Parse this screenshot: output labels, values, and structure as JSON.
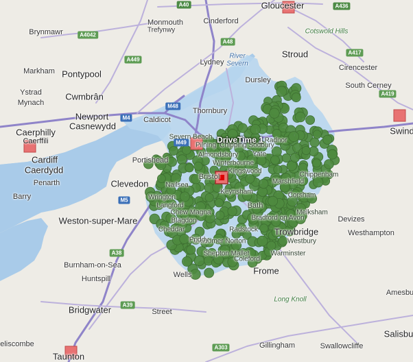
{
  "map": {
    "drivetime_label": "DriveTime 1",
    "colors": {
      "water": "#a9cbe9",
      "land": "#eeece6",
      "drivetime_area": "#b7d6ee",
      "point_fill": "#4e8a3f",
      "point_stroke": "#3d6e31",
      "site_marker": "#e87272",
      "site_marker_center": "#dd0000",
      "motorway": "#8f84c9",
      "road": "#bcb1dc"
    },
    "places": [
      {
        "name": "Gloucester",
        "kind": "town"
      },
      {
        "name": "Monmouth",
        "kind": "place"
      },
      {
        "name": "Trefynwy",
        "kind": "place"
      },
      {
        "name": "Cinderford",
        "kind": "place"
      },
      {
        "name": "Brynmawr",
        "kind": "place"
      },
      {
        "name": "Stroud",
        "kind": "town"
      },
      {
        "name": "Cotswold Hills",
        "kind": "park"
      },
      {
        "name": "River",
        "kind": "water"
      },
      {
        "name": "Severn",
        "kind": "water"
      },
      {
        "name": "Lydney",
        "kind": "place"
      },
      {
        "name": "Cirencester",
        "kind": "place"
      },
      {
        "name": "Markham",
        "kind": "place"
      },
      {
        "name": "Pontypool",
        "kind": "town"
      },
      {
        "name": "Ystrad",
        "kind": "place"
      },
      {
        "name": "Mynach",
        "kind": "place"
      },
      {
        "name": "Cwmbrân",
        "kind": "town"
      },
      {
        "name": "Dursley",
        "kind": "place"
      },
      {
        "name": "South Cerney",
        "kind": "place"
      },
      {
        "name": "Thornbury",
        "kind": "place"
      },
      {
        "name": "Newport",
        "kind": "town"
      },
      {
        "name": "Casnewydd",
        "kind": "town"
      },
      {
        "name": "Caldicot",
        "kind": "place"
      },
      {
        "name": "Caerphilly",
        "kind": "town"
      },
      {
        "name": "Caerffili",
        "kind": "town"
      },
      {
        "name": "Swind",
        "kind": "town"
      },
      {
        "name": "Cardiff",
        "kind": "town"
      },
      {
        "name": "Caerdydd",
        "kind": "town"
      },
      {
        "name": "Portishead",
        "kind": "place"
      },
      {
        "name": "Penarth",
        "kind": "place"
      },
      {
        "name": "Clevedon",
        "kind": "place"
      },
      {
        "name": "Barry",
        "kind": "place"
      },
      {
        "name": "Weston-super-Mare",
        "kind": "town"
      },
      {
        "name": "Devizes",
        "kind": "place"
      },
      {
        "name": "Trowbridge",
        "kind": "town"
      },
      {
        "name": "Westhampton",
        "kind": "place"
      },
      {
        "name": "Burnham-on-Sea",
        "kind": "place"
      },
      {
        "name": "Huntspill",
        "kind": "place"
      },
      {
        "name": "Frome",
        "kind": "town"
      },
      {
        "name": "Wells",
        "kind": "town"
      },
      {
        "name": "Long Knoll",
        "kind": "park"
      },
      {
        "name": "Amesbu",
        "kind": "place"
      },
      {
        "name": "Bridgwater",
        "kind": "town"
      },
      {
        "name": "Street",
        "kind": "place"
      },
      {
        "name": "Salisbu",
        "kind": "town"
      },
      {
        "name": "Gillingham",
        "kind": "place"
      },
      {
        "name": "Swallowcliffe",
        "kind": "place"
      },
      {
        "name": "Taunton",
        "kind": "town"
      },
      {
        "name": "eliscombe",
        "kind": "place"
      },
      {
        "name": "Bristol",
        "kind": "town"
      },
      {
        "name": "Bath",
        "kind": "town"
      },
      {
        "name": "Chipping Sodbury",
        "kind": "place"
      },
      {
        "name": "Yate",
        "kind": "place"
      },
      {
        "name": "Chippenham",
        "kind": "town"
      },
      {
        "name": "Kingswood",
        "kind": "place"
      },
      {
        "name": "Cheddar",
        "kind": "place"
      },
      {
        "name": "Shepton Mallet",
        "kind": "place"
      },
      {
        "name": "Radstock",
        "kind": "place"
      },
      {
        "name": "Marshfield",
        "kind": "place"
      },
      {
        "name": "Chew Magna",
        "kind": "place"
      },
      {
        "name": "Nailsea",
        "kind": "place"
      },
      {
        "name": "Keynsham",
        "kind": "place"
      },
      {
        "name": "Midsomer Norton",
        "kind": "place"
      },
      {
        "name": "Winterbourne",
        "kind": "place"
      },
      {
        "name": "Almondsbury",
        "kind": "place"
      },
      {
        "name": "Corsham",
        "kind": "place"
      },
      {
        "name": "Bradford on Avon",
        "kind": "place"
      },
      {
        "name": "Melksham",
        "kind": "place"
      },
      {
        "name": "Pilning",
        "kind": "place"
      },
      {
        "name": "Severn Beach",
        "kind": "place"
      },
      {
        "name": "Radnor",
        "kind": "place"
      },
      {
        "name": "Blagdon",
        "kind": "place"
      },
      {
        "name": "Langford",
        "kind": "place"
      },
      {
        "name": "Wrington",
        "kind": "place"
      },
      {
        "name": "Priddy",
        "kind": "place"
      },
      {
        "name": "Coleford",
        "kind": "place"
      },
      {
        "name": "Warminster",
        "kind": "place"
      },
      {
        "name": "Westbury",
        "kind": "place"
      }
    ],
    "road_shields": [
      {
        "label": "A40",
        "kind": "primary"
      },
      {
        "label": "A436",
        "kind": "primary"
      },
      {
        "label": "A4042",
        "kind": "a"
      },
      {
        "label": "A48",
        "kind": "a"
      },
      {
        "label": "A449",
        "kind": "a"
      },
      {
        "label": "A417",
        "kind": "a"
      },
      {
        "label": "A419",
        "kind": "a"
      },
      {
        "label": "M48",
        "kind": "mway"
      },
      {
        "label": "M4",
        "kind": "mway"
      },
      {
        "label": "M49",
        "kind": "mway"
      },
      {
        "label": "M5",
        "kind": "mway"
      },
      {
        "label": "A38",
        "kind": "a"
      },
      {
        "label": "A39",
        "kind": "a"
      },
      {
        "label": "A303",
        "kind": "a"
      }
    ]
  }
}
